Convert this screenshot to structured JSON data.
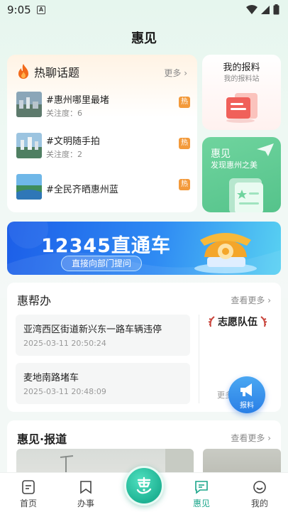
{
  "status_bar": {
    "time": "9:05",
    "badge": "A"
  },
  "page": {
    "title": "惠见"
  },
  "hot_topics": {
    "heading": "热聊话题",
    "more": "更多",
    "items": [
      {
        "title": "#惠州哪里最堵",
        "attention": "关注度：6",
        "tag": "热"
      },
      {
        "title": "#文明随手拍",
        "attention": "关注度：2",
        "tag": "热"
      },
      {
        "title": "#全民齐晒惠州蓝",
        "attention": "",
        "tag": "热"
      }
    ]
  },
  "my_report": {
    "title": "我的报料",
    "subtitle": "我的报料站"
  },
  "huijian_card": {
    "title": "惠见",
    "subtitle": "发现惠州之美"
  },
  "banner": {
    "title": "12345直通车",
    "button": "直接向部门提问"
  },
  "help_section": {
    "heading": "惠帮办",
    "more": "查看更多",
    "items": [
      {
        "title": "亚湾西区街道新兴东一路车辆违停",
        "date": "2025-03-11 20:50:24"
      },
      {
        "title": "麦地南路堵车",
        "date": "2025-03-11 20:48:09"
      }
    ],
    "volunteer": "志愿队伍",
    "volunteer_more": "更多"
  },
  "fab": {
    "label": "报料"
  },
  "report_section": {
    "heading": "惠见·报道",
    "more": "查看更多"
  },
  "bottom_nav": {
    "items": [
      {
        "label": "首页"
      },
      {
        "label": "办事"
      },
      {
        "label": "惠见"
      },
      {
        "label": "我的"
      }
    ],
    "active": "惠见"
  },
  "colors": {
    "accent": "#1aa58a",
    "hot_tag": "#f39a3b",
    "banner_blue": "#1c5ee8"
  }
}
